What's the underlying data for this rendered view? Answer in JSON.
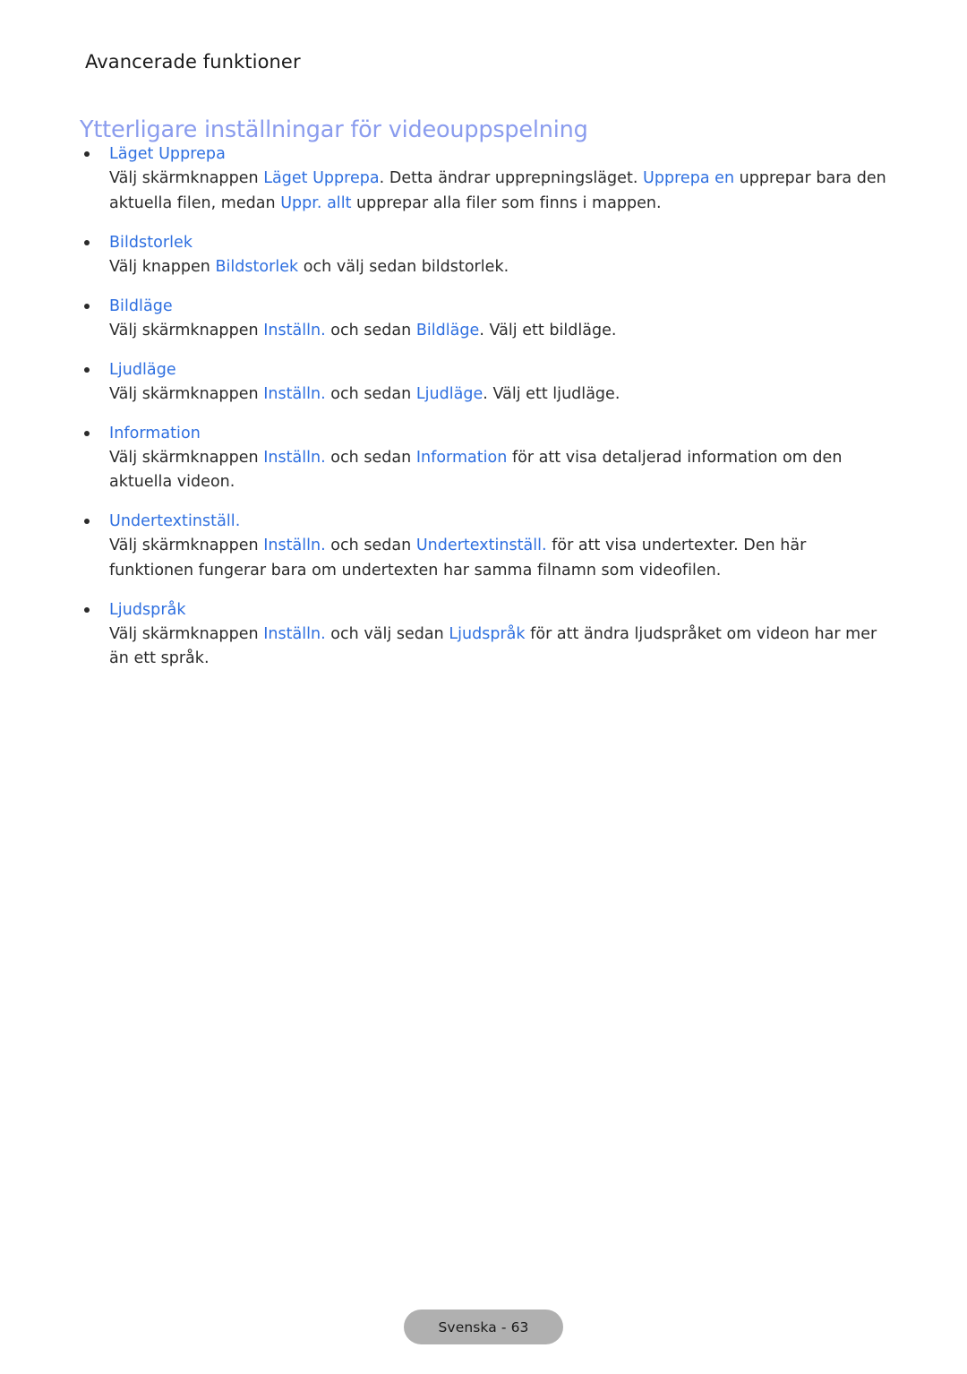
{
  "header": {
    "running_title": "Avancerade funktioner",
    "section_heading": "Ytterligare inställningar för videouppspelning"
  },
  "colors": {
    "section_heading": "#8a9cee",
    "term_blue": "#2e6fe0",
    "body_text": "#2b2b2b",
    "footer_pill_bg": "#b0b0b0"
  },
  "items": [
    {
      "term": "Läget Upprepa",
      "body_parts": [
        {
          "text": "Välj skärmknappen ",
          "highlight": false
        },
        {
          "text": "Läget Upprepa",
          "highlight": true
        },
        {
          "text": ". Detta ändrar upprepningsläget. ",
          "highlight": false
        },
        {
          "text": "Upprepa en",
          "highlight": true
        },
        {
          "text": " upprepar bara den aktuella filen, medan ",
          "highlight": false
        },
        {
          "text": "Uppr. allt",
          "highlight": true
        },
        {
          "text": " upprepar alla filer som finns i mappen.",
          "highlight": false
        }
      ]
    },
    {
      "term": "Bildstorlek",
      "body_parts": [
        {
          "text": "Välj knappen ",
          "highlight": false
        },
        {
          "text": "Bildstorlek",
          "highlight": true
        },
        {
          "text": " och välj sedan bildstorlek.",
          "highlight": false
        }
      ]
    },
    {
      "term": "Bildläge",
      "body_parts": [
        {
          "text": "Välj skärmknappen ",
          "highlight": false
        },
        {
          "text": "Inställn.",
          "highlight": true
        },
        {
          "text": " och sedan ",
          "highlight": false
        },
        {
          "text": "Bildläge",
          "highlight": true
        },
        {
          "text": ". Välj ett bildläge.",
          "highlight": false
        }
      ]
    },
    {
      "term": "Ljudläge",
      "body_parts": [
        {
          "text": "Välj skärmknappen ",
          "highlight": false
        },
        {
          "text": "Inställn.",
          "highlight": true
        },
        {
          "text": " och sedan ",
          "highlight": false
        },
        {
          "text": "Ljudläge",
          "highlight": true
        },
        {
          "text": ". Välj ett ljudläge.",
          "highlight": false
        }
      ]
    },
    {
      "term": "Information",
      "body_parts": [
        {
          "text": "Välj skärmknappen ",
          "highlight": false
        },
        {
          "text": "Inställn.",
          "highlight": true
        },
        {
          "text": " och sedan ",
          "highlight": false
        },
        {
          "text": "Information",
          "highlight": true
        },
        {
          "text": " för att visa detaljerad information om den aktuella videon.",
          "highlight": false
        }
      ]
    },
    {
      "term": "Undertextinställ.",
      "body_parts": [
        {
          "text": "Välj skärmknappen ",
          "highlight": false
        },
        {
          "text": "Inställn.",
          "highlight": true
        },
        {
          "text": " och sedan ",
          "highlight": false
        },
        {
          "text": "Undertextinställ.",
          "highlight": true
        },
        {
          "text": " för att visa undertexter. Den här funktionen fungerar bara om undertexten har samma filnamn som videofilen.",
          "highlight": false
        }
      ]
    },
    {
      "term": "Ljudspråk",
      "body_parts": [
        {
          "text": "Välj skärmknappen ",
          "highlight": false
        },
        {
          "text": "Inställn.",
          "highlight": true
        },
        {
          "text": " och välj sedan ",
          "highlight": false
        },
        {
          "text": "Ljudspråk",
          "highlight": true
        },
        {
          "text": " för att ändra ljudspråket om videon har mer än ett språk.",
          "highlight": false
        }
      ]
    }
  ],
  "footer": {
    "page_label": "Svenska - 63"
  }
}
